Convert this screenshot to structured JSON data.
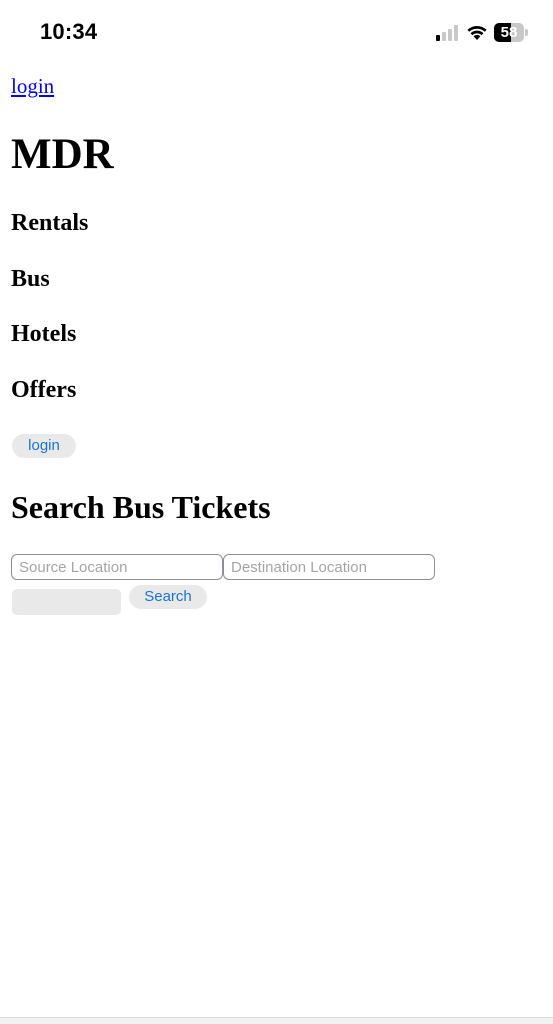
{
  "status_bar": {
    "time": "10:34",
    "battery_level": "58",
    "signal_bars_active": 1,
    "signal_bars_total": 4
  },
  "header": {
    "login_link": "login",
    "brand": "MDR"
  },
  "nav": {
    "items": [
      {
        "label": "Rentals"
      },
      {
        "label": "Bus"
      },
      {
        "label": "Hotels"
      },
      {
        "label": "Offers"
      }
    ],
    "login_button": "login"
  },
  "search": {
    "title": "Search Bus Tickets",
    "source_placeholder": "Source Location",
    "destination_placeholder": "Destination Location",
    "date_value": "",
    "button_label": "Search"
  },
  "colors": {
    "link": "#0000ee",
    "button_text": "#1a73d0",
    "button_bg": "#e9e9ea"
  }
}
